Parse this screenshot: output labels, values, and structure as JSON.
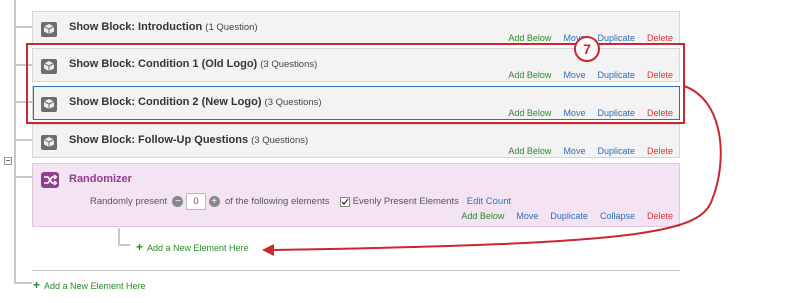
{
  "blocks": [
    {
      "title": "Show Block: Introduction",
      "count": "(1 Question)"
    },
    {
      "title": "Show Block: Condition 1 (Old Logo)",
      "count": "(3 Questions)"
    },
    {
      "title": "Show Block: Condition 2 (New Logo)",
      "count": "(3 Questions)"
    },
    {
      "title": "Show Block: Follow-Up Questions",
      "count": "(3 Questions)"
    }
  ],
  "block_actions": {
    "add_below": "Add Below",
    "move": "Move",
    "duplicate": "Duplicate",
    "delete": "Delete"
  },
  "randomizer": {
    "title": "Randomizer",
    "present_prefix": "Randomly present",
    "present_value": "0",
    "present_suffix": "of the following elements",
    "evenly_label": "Evenly Present Elements",
    "edit_count": "Edit Count",
    "actions": {
      "add_below": "Add Below",
      "move": "Move",
      "duplicate": "Duplicate",
      "collapse": "Collapse",
      "delete": "Delete"
    }
  },
  "add_new_inner": "Add a New Element Here",
  "add_new_outer": "Add a New Element Here",
  "badge_number": "7",
  "icons": {
    "block": "cube-icon",
    "randomizer": "shuffle-icon",
    "minus": "minus-icon",
    "plus": "plus-icon"
  },
  "colors": {
    "highlight": "#c8282e",
    "selection": "#2b6fb5",
    "randomizer": "#8e3e8b"
  }
}
